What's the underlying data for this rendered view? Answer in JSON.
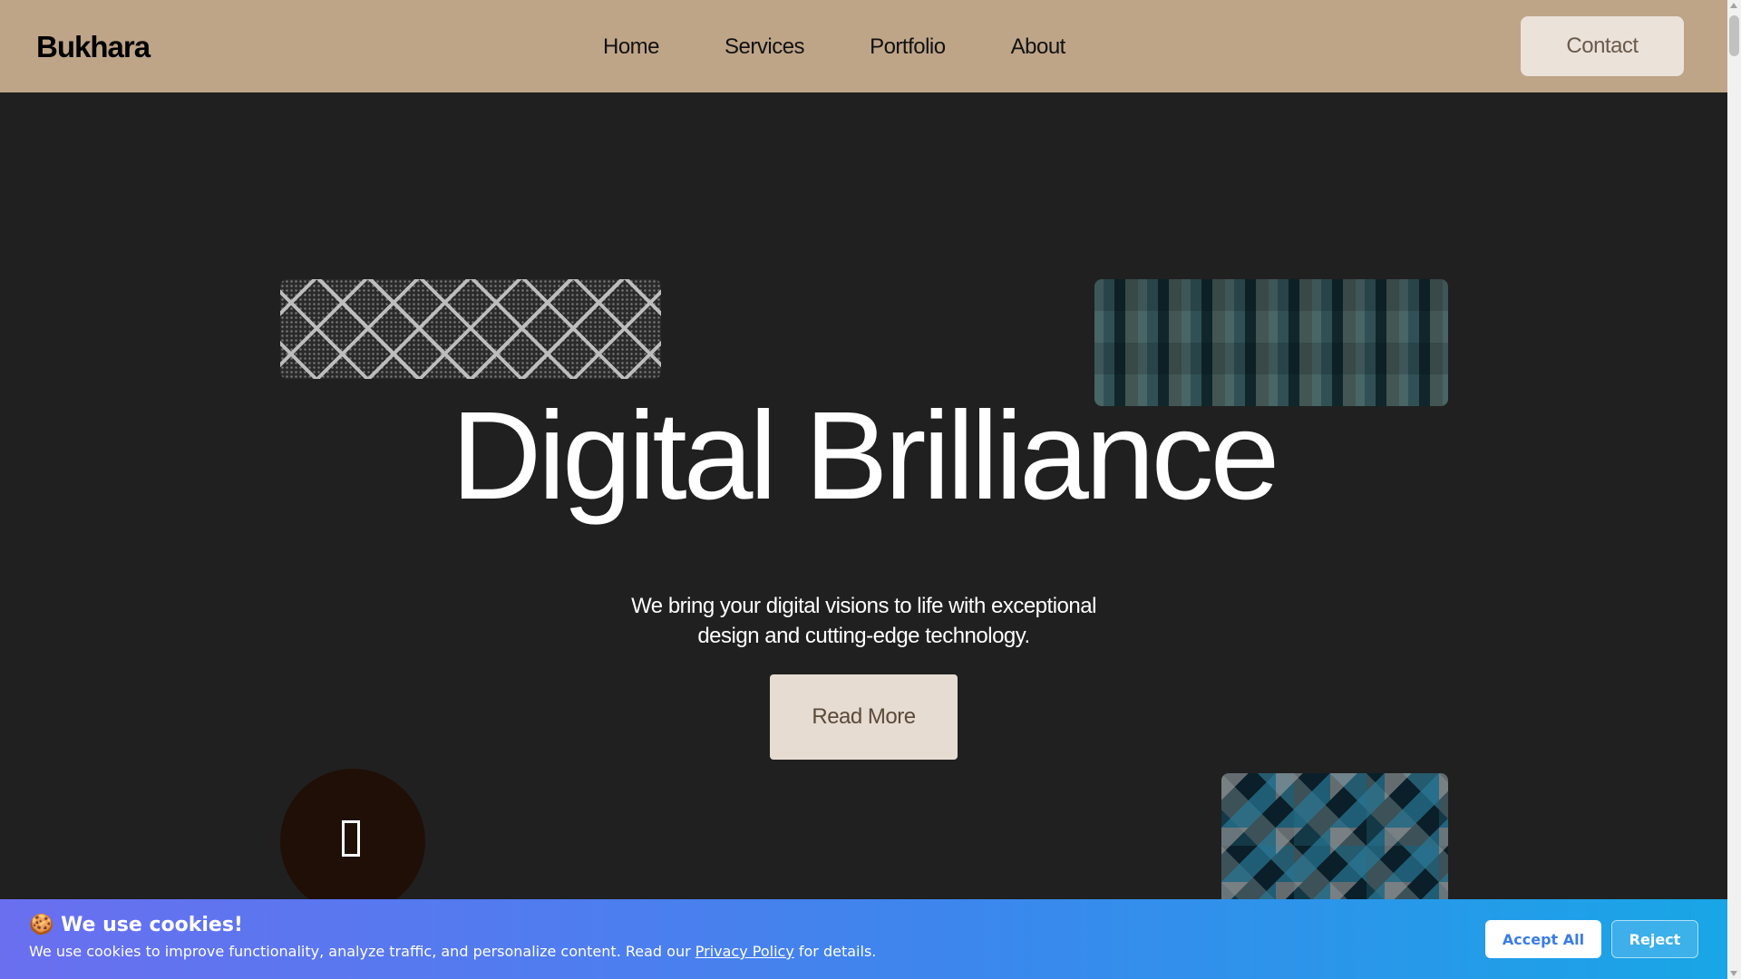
{
  "header": {
    "logo": "Bukhara",
    "nav": [
      "Home",
      "Services",
      "Portfolio",
      "About"
    ],
    "contact_label": "Contact"
  },
  "hero": {
    "title": "Digital Brilliance",
    "subtitle_line1": "We bring your digital visions to life with exceptional",
    "subtitle_line2": "design and cutting-edge technology.",
    "cta_label": "Read More"
  },
  "cookie_banner": {
    "emoji": "🍪",
    "title": "We use cookies!",
    "text_before": "We use cookies to improve functionality, analyze traffic, and personalize content. Read our ",
    "link_label": "Privacy Policy",
    "text_after": " for details.",
    "accept_label": "Accept All",
    "reject_label": "Reject"
  },
  "colors": {
    "header_bg": "#bfa588",
    "page_bg": "#202020",
    "cta_bg": "#e6dcd2",
    "banner_gradient_start": "#6a6ff0",
    "banner_gradient_end": "#18a6e6"
  },
  "icons": {
    "circle_icon": "missing-glyph-icon"
  }
}
